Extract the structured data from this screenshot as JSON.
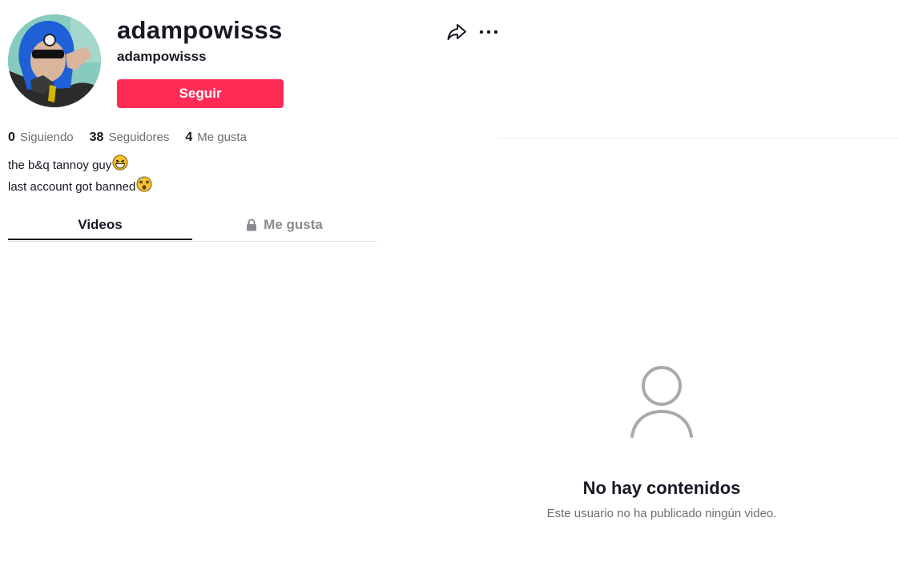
{
  "profile": {
    "display_name": "adampowisss",
    "username": "adampowisss",
    "follow_label": "Seguir"
  },
  "icons": {
    "share": "share-icon",
    "more": "more-options-icon",
    "lock": "lock-icon",
    "empty": "user-silhouette-icon"
  },
  "stats": {
    "following": {
      "value": "0",
      "label": "Siguiendo"
    },
    "followers": {
      "value": "38",
      "label": "Seguidores"
    },
    "likes": {
      "value": "4",
      "label": "Me gusta"
    }
  },
  "bio": {
    "line1": "the b&q tannoy guy",
    "line1_emoji": "grinning-squinting-face",
    "line2": "last account got banned",
    "line2_emoji": "dizzy-face"
  },
  "tabs": {
    "videos": "Videos",
    "likes": "Me gusta"
  },
  "empty_state": {
    "title": "No hay contenidos",
    "description": "Este usuario no ha publicado ningún video."
  },
  "colors": {
    "accent": "#fe2c55",
    "text": "#161823",
    "muted": "#6b6d74"
  }
}
